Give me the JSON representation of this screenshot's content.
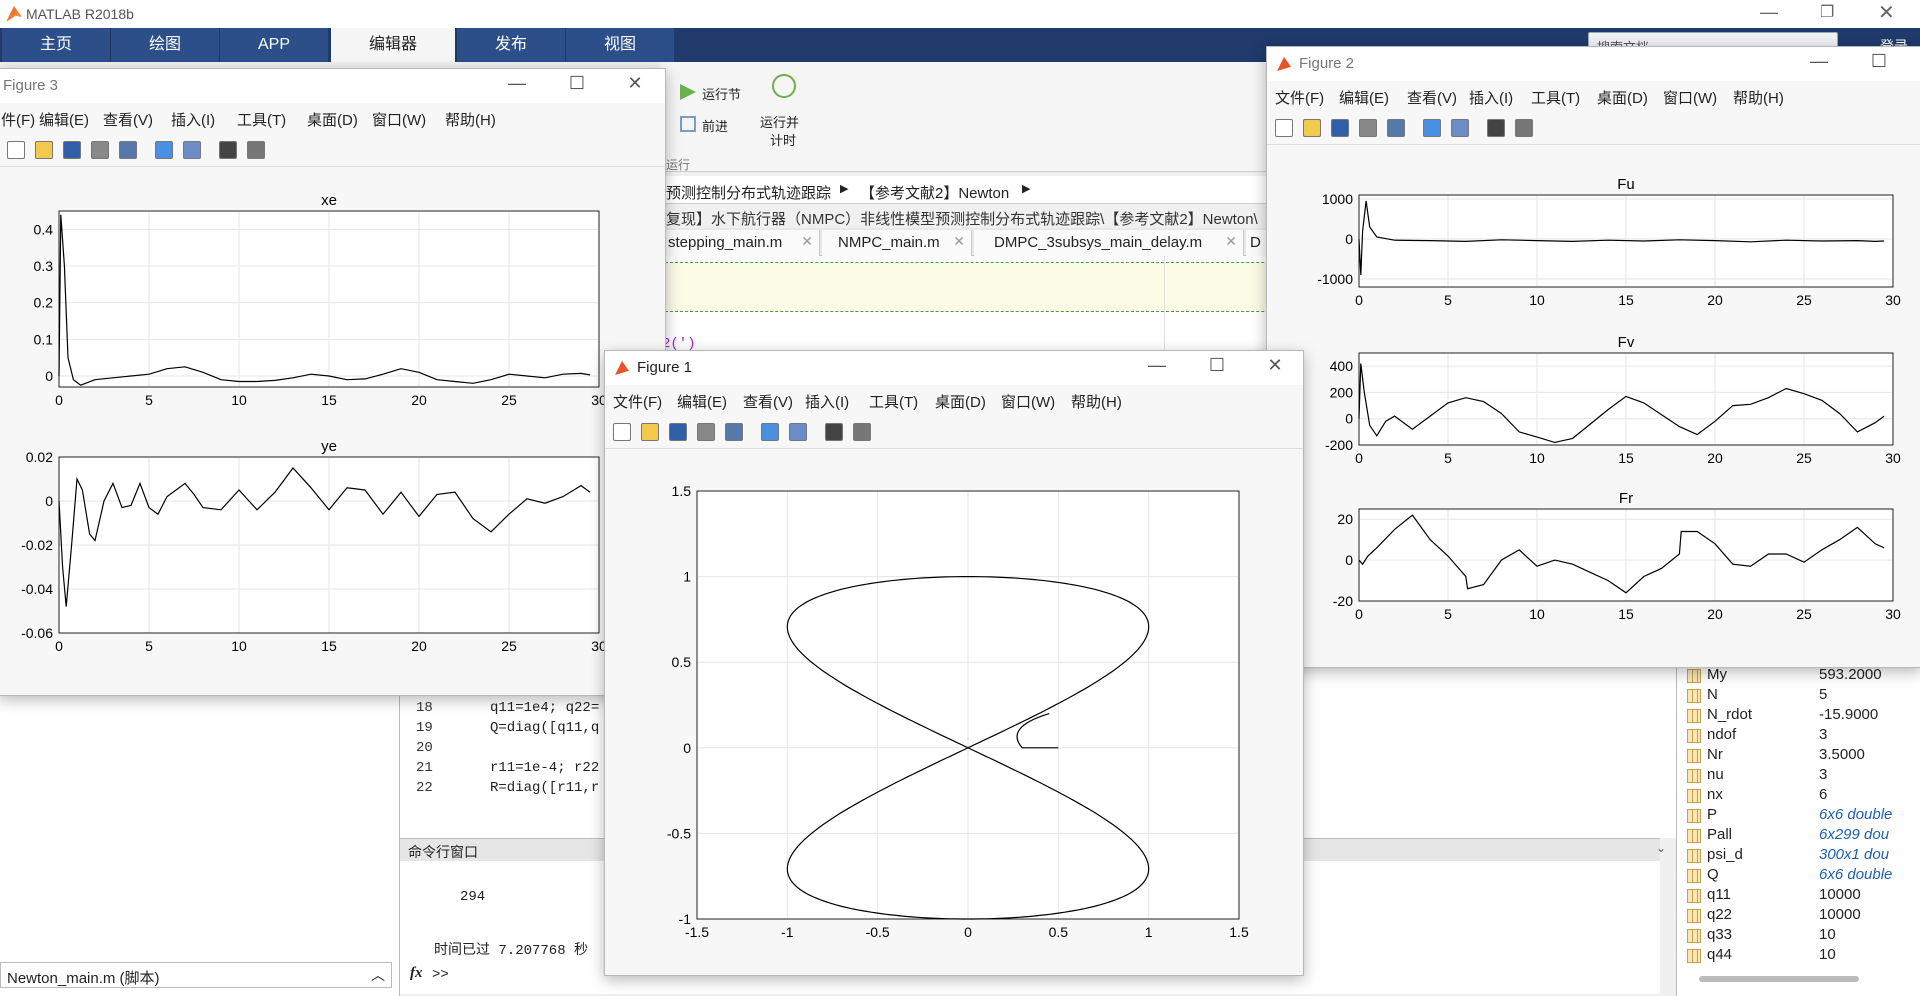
{
  "app": {
    "title": "MATLAB R2018b",
    "search_placeholder": "搜索文档",
    "signin": "登录"
  },
  "ribbon": {
    "tabs": [
      "主页",
      "绘图",
      "APP",
      "编辑器",
      "发布",
      "视图"
    ]
  },
  "editor_tools": {
    "run_section": "运行节",
    "advance": "前进",
    "run_time_1": "运行并",
    "run_time_2": "计时",
    "group": "运行"
  },
  "breadcrumb": {
    "crumb1": "预测控制分布式轨迹跟踪",
    "crumb2": "【参考文献2】Newton",
    "path": "复现】水下航行器（NMPC）非线性模型预测控制分布式轨迹跟踪\\【参考文献2】Newton\\"
  },
  "editor_tabs": [
    "stepping_main.m",
    "NMPC_main.m",
    "DMPC_3subsys_main_delay.m",
    "D"
  ],
  "code": {
    "partial": "2(')",
    "lines": [
      {
        "num": "18",
        "text": "q11=1e4; q22="
      },
      {
        "num": "19",
        "text": "Q=diag([q11,q"
      },
      {
        "num": "20",
        "text": ""
      },
      {
        "num": "21",
        "text": "r11=1e-4; r22"
      },
      {
        "num": "22",
        "text": "R=diag([r11,r"
      }
    ]
  },
  "command_window": {
    "title": "命令行窗口",
    "output": "294",
    "elapsed": "时间已过 7.207768 秒",
    "prompt": ">>",
    "fx": "fx"
  },
  "current_file": {
    "label": "Newton_main.m (脚本)"
  },
  "workspace": [
    {
      "name": "My",
      "value": "593.2000",
      "italic": false
    },
    {
      "name": "N",
      "value": "5",
      "italic": false
    },
    {
      "name": "N_rdot",
      "value": "-15.9000",
      "italic": false
    },
    {
      "name": "ndof",
      "value": "3",
      "italic": false
    },
    {
      "name": "Nr",
      "value": "3.5000",
      "italic": false
    },
    {
      "name": "nu",
      "value": "3",
      "italic": false
    },
    {
      "name": "nx",
      "value": "6",
      "italic": false
    },
    {
      "name": "P",
      "value": "6x6 double",
      "italic": true
    },
    {
      "name": "Pall",
      "value": "6x299 dou",
      "italic": true
    },
    {
      "name": "psi_d",
      "value": "300x1 dou",
      "italic": true
    },
    {
      "name": "Q",
      "value": "6x6 double",
      "italic": true
    },
    {
      "name": "q11",
      "value": "10000",
      "italic": false
    },
    {
      "name": "q22",
      "value": "10000",
      "italic": false
    },
    {
      "name": "q33",
      "value": "10",
      "italic": false
    },
    {
      "name": "q44",
      "value": "10",
      "italic": false
    }
  ],
  "figure_menu": [
    "文件(F)",
    "编辑(E)",
    "查看(V)",
    "插入(I)",
    "工具(T)",
    "桌面(D)",
    "窗口(W)",
    "帮助(H)"
  ],
  "figure3": {
    "title": "Figure 3",
    "menu_first": "件(F)"
  },
  "figure2": {
    "title": "Figure 2"
  },
  "figure1": {
    "title": "Figure 1"
  },
  "colors": {
    "ribbon": "#1f3a6b",
    "ribbon_tab": "#2c4f8a",
    "selected": "#ffffff",
    "plot_line": "#000000"
  },
  "chart_data": [
    {
      "id": "xe",
      "type": "line",
      "title": "xe",
      "xlim": [
        0,
        30
      ],
      "ylim": [
        -0.03,
        0.45
      ],
      "yticks": [
        0,
        0.1,
        0.2,
        0.3,
        0.4
      ],
      "ytick_labels": [
        "0",
        "0.1",
        "0.2",
        "0.3",
        "0.4"
      ],
      "xticks": [
        0,
        5,
        10,
        15,
        20,
        25,
        30
      ],
      "xtick_labels": [
        "0",
        "5",
        "10",
        "15",
        "20",
        "25",
        "30"
      ],
      "grid": true,
      "x": [
        0,
        0.1,
        0.3,
        0.5,
        0.8,
        1.2,
        2,
        3,
        4,
        5,
        6,
        7,
        8,
        9,
        10,
        11,
        12,
        13,
        14,
        15,
        16,
        17,
        18,
        19,
        20,
        21,
        22,
        23,
        24,
        25,
        26,
        27,
        28,
        29,
        29.5
      ],
      "y": [
        0,
        0.44,
        0.3,
        0.05,
        -0.01,
        -0.025,
        -0.01,
        -0.005,
        0.0,
        0.005,
        0.02,
        0.025,
        0.01,
        -0.01,
        -0.015,
        -0.015,
        -0.012,
        -0.005,
        0.005,
        0.0,
        -0.01,
        -0.008,
        0.005,
        0.02,
        0.01,
        -0.01,
        -0.015,
        -0.02,
        -0.01,
        0.005,
        0.0,
        -0.005,
        0.005,
        0.007,
        0.003
      ]
    },
    {
      "id": "ye",
      "type": "line",
      "title": "ye",
      "xlim": [
        0,
        30
      ],
      "ylim": [
        -0.06,
        0.02
      ],
      "yticks": [
        -0.06,
        -0.04,
        -0.02,
        0,
        0.02
      ],
      "ytick_labels": [
        "-0.06",
        "-0.04",
        "-0.02",
        "0",
        "0.02"
      ],
      "xticks": [
        0,
        5,
        10,
        15,
        20,
        25,
        30
      ],
      "xtick_labels": [
        "0",
        "5",
        "10",
        "15",
        "20",
        "25",
        "30"
      ],
      "grid": true,
      "x": [
        0,
        0.2,
        0.4,
        0.7,
        1,
        1.3,
        1.7,
        2,
        2.5,
        3,
        3.5,
        4,
        4.5,
        5,
        5.5,
        6,
        7,
        7.5,
        8,
        9,
        10,
        11,
        12,
        13,
        14,
        15,
        16,
        17,
        18,
        19,
        20,
        21,
        22,
        23,
        24,
        25,
        26,
        27,
        28,
        29,
        29.5
      ],
      "y": [
        0,
        -0.03,
        -0.048,
        -0.02,
        0.01,
        0.005,
        -0.015,
        -0.018,
        0.0,
        0.008,
        -0.003,
        -0.002,
        0.008,
        -0.003,
        -0.006,
        0.002,
        0.008,
        0.003,
        -0.003,
        -0.004,
        0.005,
        -0.004,
        0.004,
        0.015,
        0.006,
        -0.004,
        0.006,
        0.005,
        -0.006,
        0.004,
        -0.007,
        0.003,
        0.004,
        -0.008,
        -0.014,
        -0.006,
        0.001,
        -0.001,
        0.002,
        0.007,
        0.004
      ]
    },
    {
      "id": "Fu",
      "type": "line",
      "title": "Fu",
      "xlim": [
        0,
        30
      ],
      "ylim": [
        -1200,
        1100
      ],
      "yticks": [
        -1000,
        0,
        1000
      ],
      "ytick_labels": [
        "-1000",
        "0",
        "1000"
      ],
      "xticks": [
        0,
        5,
        10,
        15,
        20,
        25,
        30
      ],
      "xtick_labels": [
        "0",
        "5",
        "10",
        "15",
        "20",
        "25",
        "30"
      ],
      "grid": true,
      "x": [
        0,
        0.1,
        0.2,
        0.4,
        0.6,
        1,
        2,
        4,
        6,
        8,
        10,
        12,
        14,
        16,
        18,
        20,
        22,
        24,
        26,
        28,
        29,
        29.5
      ],
      "y": [
        0,
        -900,
        200,
        950,
        300,
        50,
        -30,
        -40,
        -60,
        -20,
        -40,
        -60,
        -30,
        -50,
        -20,
        -40,
        -70,
        -30,
        -50,
        -40,
        -60,
        -50
      ]
    },
    {
      "id": "Fv",
      "type": "line",
      "title": "Fv",
      "xlim": [
        0,
        30
      ],
      "ylim": [
        -200,
        500
      ],
      "yticks": [
        -200,
        0,
        200,
        400
      ],
      "ytick_labels": [
        "-200",
        "0",
        "200",
        "400"
      ],
      "xticks": [
        0,
        5,
        10,
        15,
        20,
        25,
        30
      ],
      "xtick_labels": [
        "0",
        "5",
        "10",
        "15",
        "20",
        "25",
        "30"
      ],
      "grid": true,
      "x": [
        0,
        0.1,
        0.3,
        0.6,
        1,
        1.5,
        2,
        3,
        4,
        5,
        6,
        7,
        8,
        9,
        10,
        11,
        12,
        13,
        14,
        15,
        16,
        17,
        18,
        19,
        20,
        21,
        22,
        23,
        24,
        25,
        26,
        27,
        28,
        29,
        29.5
      ],
      "y": [
        0,
        420,
        200,
        -50,
        -130,
        -20,
        20,
        -80,
        20,
        120,
        160,
        130,
        40,
        -100,
        -140,
        -180,
        -150,
        -40,
        70,
        170,
        120,
        30,
        -60,
        -120,
        -20,
        100,
        110,
        160,
        230,
        190,
        140,
        40,
        -100,
        -30,
        20
      ]
    },
    {
      "id": "Fr",
      "type": "line",
      "title": "Fr",
      "xlim": [
        0,
        30
      ],
      "ylim": [
        -20,
        25
      ],
      "yticks": [
        -20,
        0,
        20
      ],
      "ytick_labels": [
        "-20",
        "0",
        "20"
      ],
      "xticks": [
        0,
        5,
        10,
        15,
        20,
        25,
        30
      ],
      "xtick_labels": [
        "0",
        "5",
        "10",
        "15",
        "20",
        "25",
        "30"
      ],
      "grid": true,
      "x": [
        0,
        0.2,
        0.5,
        1,
        2,
        3,
        4,
        5,
        6,
        6.1,
        7,
        8,
        9,
        10,
        11,
        12,
        13,
        14,
        15,
        16,
        17,
        18,
        18.1,
        19,
        20,
        21,
        22,
        23,
        24,
        25,
        26,
        27,
        28,
        29,
        29.5
      ],
      "y": [
        0,
        -2,
        2,
        6,
        15,
        22,
        10,
        2,
        -8,
        -14,
        -12,
        0,
        5,
        -3,
        0,
        -2,
        -6,
        -10,
        -16,
        -8,
        -4,
        3,
        14,
        14,
        8,
        -2,
        -3,
        3,
        3,
        -1,
        5,
        10,
        16,
        8,
        6
      ]
    },
    {
      "id": "trajectory",
      "type": "line",
      "title": "",
      "xlim": [
        -1.5,
        1.5
      ],
      "ylim": [
        -1,
        1.5
      ],
      "xticks": [
        -1.5,
        -1,
        -0.5,
        0,
        0.5,
        1,
        1.5
      ],
      "xtick_labels": [
        "-1.5",
        "-1",
        "-0.5",
        "0",
        "0.5",
        "1",
        "1.5"
      ],
      "yticks": [
        -1,
        -0.5,
        0,
        0.5,
        1,
        1.5
      ],
      "ytick_labels": [
        "-1",
        "-0.5",
        "0",
        "0.5",
        "1",
        "1.5"
      ],
      "grid": true,
      "shape": "figure-eight",
      "x_amplitude": 1,
      "y_amplitude": 1,
      "start": [
        0.5,
        0
      ]
    }
  ]
}
